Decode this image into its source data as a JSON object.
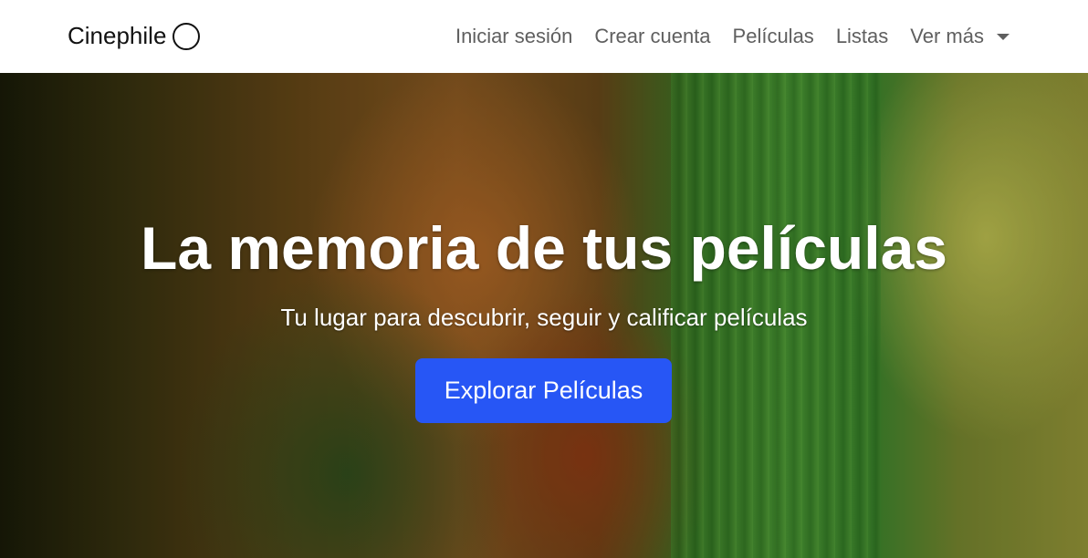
{
  "navbar": {
    "brand": "Cinephile",
    "brand_icon": "circle-logo-icon",
    "links": [
      {
        "label": "Iniciar sesión"
      },
      {
        "label": "Crear cuenta"
      },
      {
        "label": "Películas"
      },
      {
        "label": "Listas"
      }
    ],
    "dropdown": {
      "label": "Ver más",
      "icon": "caret-down-icon"
    }
  },
  "hero": {
    "title": "La memoria de tus películas",
    "subtitle": "Tu lugar para descubrir, seguir y calificar películas",
    "cta_label": "Explorar Películas"
  },
  "colors": {
    "accent": "#2756f5",
    "nav_text": "#5f5f5f",
    "brand_text": "#111111"
  }
}
